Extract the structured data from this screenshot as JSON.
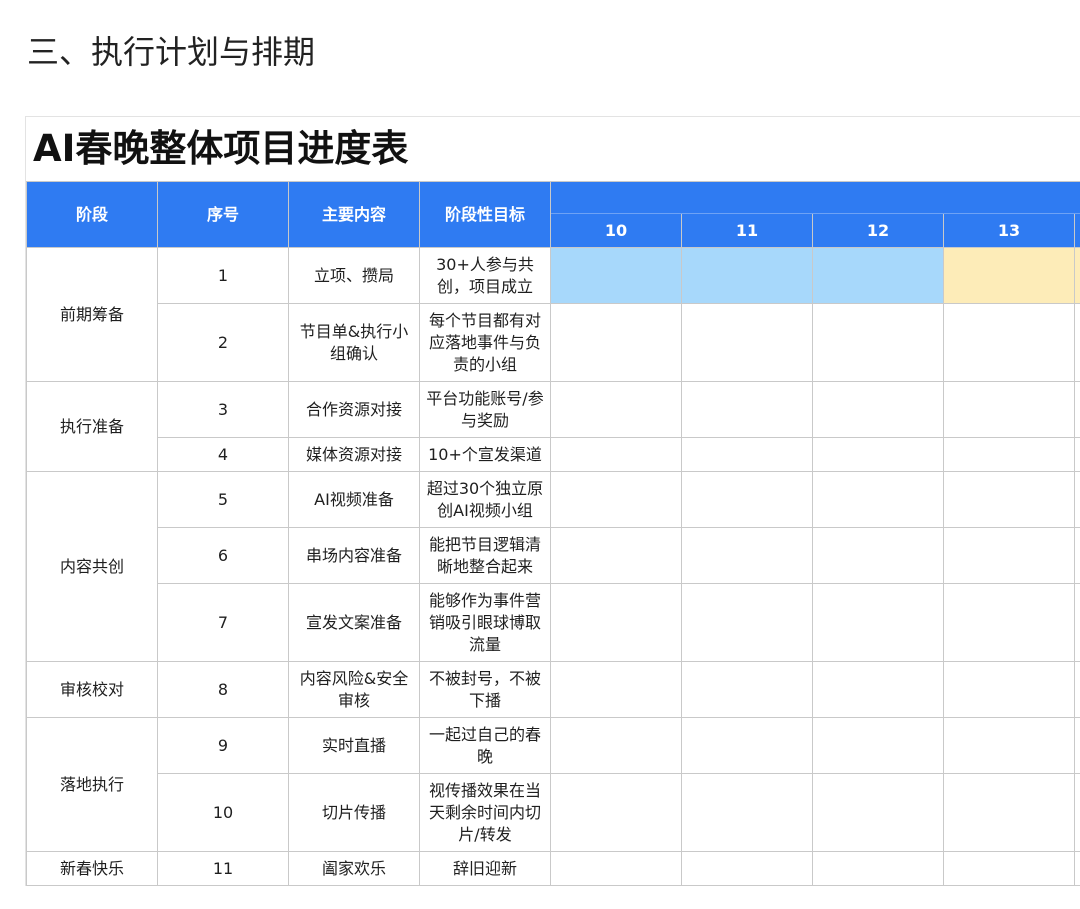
{
  "heading": "三、执行计划与排期",
  "sheet": {
    "title": "AI春晚整体项目进度表",
    "headers": {
      "phase": "阶段",
      "index": "序号",
      "content": "主要内容",
      "goal": "阶段性目标"
    },
    "days": [
      "10",
      "11",
      "12",
      "13",
      ""
    ],
    "phases": [
      "前期筹备",
      "执行准备",
      "内容共创",
      "审核校对",
      "落地执行",
      "新春快乐"
    ],
    "rows": [
      {
        "index": "1",
        "content": "立项、攒局",
        "goal": "30+人参与共创，项目成立"
      },
      {
        "index": "2",
        "content": "节目单&执行小组确认",
        "goal": "每个节目都有对应落地事件与负责的小组"
      },
      {
        "index": "3",
        "content": "合作资源对接",
        "goal": "平台功能账号/参与奖励"
      },
      {
        "index": "4",
        "content": "媒体资源对接",
        "goal": "10+个宣发渠道"
      },
      {
        "index": "5",
        "content": "AI视频准备",
        "goal": "超过30个独立原创AI视频小组"
      },
      {
        "index": "6",
        "content": "串场内容准备",
        "goal": "能把节目逻辑清晰地整合起来"
      },
      {
        "index": "7",
        "content": "宣发文案准备",
        "goal": "能够作为事件营销吸引眼球博取流量"
      },
      {
        "index": "8",
        "content": "内容风险&安全审核",
        "goal": "不被封号，不被下播"
      },
      {
        "index": "9",
        "content": "实时直播",
        "goal": "一起过自己的春晚"
      },
      {
        "index": "10",
        "content": "切片传播",
        "goal": "视传播效果在当天剩余时间内切片/转发"
      },
      {
        "index": "11",
        "content": "阖家欢乐",
        "goal": "辞旧迎新"
      }
    ],
    "colors": {
      "header_blue": "#2f7bf2",
      "gantt_blue": "#a7d8fb",
      "gantt_yellow": "#fdecb8"
    }
  }
}
